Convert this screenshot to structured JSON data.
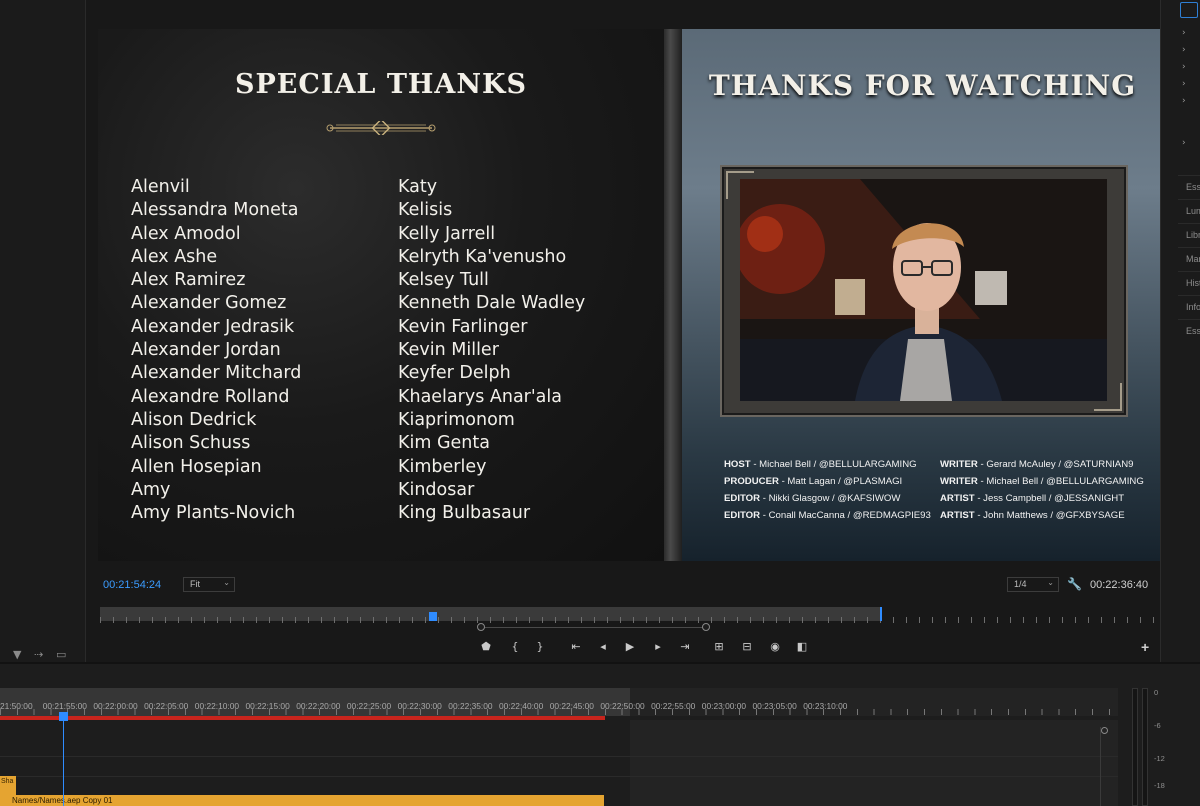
{
  "program_monitor": {
    "left_slide": {
      "title": "SPECIAL THANKS",
      "names_col1": [
        "Alenvil",
        "Alessandra Moneta",
        "Alex Amodol",
        "Alex Ashe",
        "Alex Ramirez",
        "Alexander Gomez",
        "Alexander Jedrasik",
        "Alexander Jordan",
        "Alexander Mitchard",
        "Alexandre Rolland",
        "Alison Dedrick",
        "Alison Schuss",
        "Allen Hosepian",
        "Amy",
        "Amy Plants-Novich"
      ],
      "names_col2": [
        "Katy",
        "Kelisis",
        "Kelly Jarrell",
        "Kelryth Ka'venusho",
        "Kelsey Tull",
        "Kenneth Dale Wadley",
        "Kevin Farlinger",
        "Kevin Miller",
        "Keyfer Delph",
        "Khaelarys Anar'ala",
        "Kiaprimonom",
        "Kim Genta",
        "Kimberley",
        "Kindosar",
        "King Bulbasaur"
      ]
    },
    "right_slide": {
      "title": "THANKS FOR WATCHING",
      "crew_left": [
        {
          "role": "HOST",
          "value": " - Michael Bell / @BELLULARGAMING"
        },
        {
          "role": "PRODUCER",
          "value": " - Matt Lagan / @PLASMAGI"
        },
        {
          "role": "EDITOR",
          "value": " - Nikki Glasgow / @KAFSIWOW"
        },
        {
          "role": "EDITOR",
          "value": " - Conall MacCanna / @REDMAGPIE93"
        }
      ],
      "crew_right": [
        {
          "role": "WRITER",
          "value": " - Gerard McAuley / @SATURNIAN9"
        },
        {
          "role": "WRITER",
          "value": " - Michael Bell / @BELLULARGAMING"
        },
        {
          "role": "ARTIST",
          "value": " - Jess Campbell / @JESSANIGHT"
        },
        {
          "role": "ARTIST",
          "value": " - John Matthews / @GFXBYSAGE"
        }
      ]
    },
    "current_timecode": "00:21:54:24",
    "zoom_fit": "Fit",
    "resolution": "1/4",
    "duration_timecode": "00:22:36:40"
  },
  "timeline": {
    "ruler_labels": [
      "21:50:00",
      "00:21:55:00",
      "00:22:00:00",
      "00:22:05:00",
      "00:22:10:00",
      "00:22:15:00",
      "00:22:20:00",
      "00:22:25:00",
      "00:22:30:00",
      "00:22:35:00",
      "00:22:40:00",
      "00:22:45:00",
      "00:22:50:00",
      "00:22:55:00",
      "00:23:00:00",
      "00:23:05:00",
      "00:23:10:00"
    ],
    "clip_name": "Names/Names.aep Copy 01",
    "clip_small": "Sha"
  },
  "audio_meter_labels": [
    "0",
    "-6",
    "-12",
    "-18"
  ],
  "right_panel": {
    "tabs": [
      "Essential",
      "Lumetri",
      "Libraries",
      "Markers",
      "History",
      "Info",
      "Essential"
    ]
  },
  "colors": {
    "timecode_blue": "#3b9cff",
    "playhead_blue": "#2f8cff",
    "work_area_red": "#c8241c",
    "clip_orange": "#e5a431"
  }
}
